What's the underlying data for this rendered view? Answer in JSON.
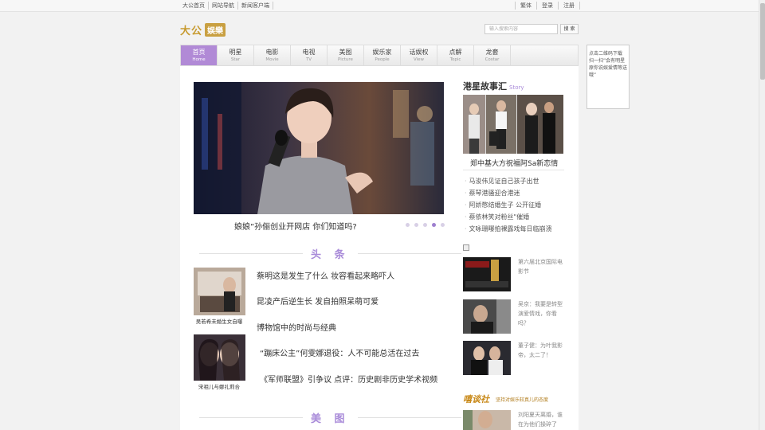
{
  "topbar": {
    "left_links": [
      "大公首页",
      "网站导航",
      "新闻客户端"
    ],
    "right_links": [
      "繁体",
      "登录",
      "注册"
    ]
  },
  "logo": {
    "brand": "大公",
    "section": "娱樂"
  },
  "search": {
    "placeholder": "输入搜索内容",
    "button": "搜 索"
  },
  "nav": [
    {
      "cn": "首页",
      "en": "Home",
      "active": true
    },
    {
      "cn": "明星",
      "en": "Star"
    },
    {
      "cn": "电影",
      "en": "Movie"
    },
    {
      "cn": "电视",
      "en": "TV"
    },
    {
      "cn": "美图",
      "en": "Picture"
    },
    {
      "cn": "娱乐家",
      "en": "People"
    },
    {
      "cn": "话娱权",
      "en": "View"
    },
    {
      "cn": "点解",
      "en": "Topic"
    },
    {
      "cn": "龙套",
      "en": "Costar"
    }
  ],
  "hero": {
    "caption": "娘娘”孙俪创业开网店 你们知道吗?",
    "slides": 5,
    "active_slide": 4
  },
  "sections": {
    "headline": "头 条",
    "pictures": "美 图"
  },
  "headline_thumbs": [
    {
      "caption": "吴若希未婚生女自曝"
    },
    {
      "caption": "宋祖儿与娜扎莉合"
    }
  ],
  "headline_links": [
    "蔡明这是发生了什么 妆容看起来略吓人",
    "昆凌产后逆生长 发自拍照呆萌可爱",
    "博物馆中的时尚与经典",
    "“蹦床公主”何雯娜退役：人不可能总活在过去",
    "《军师联盟》引争议 点评：历史剧非历史学术视频"
  ],
  "story": {
    "title": "港星故事汇",
    "title_en": "Story",
    "feature": "郑中基大方祝福阿Sa新恋情",
    "list": [
      "马浚伟见证自己孩子出世",
      "蔡琴港骚迎合港迷",
      "阿娇憋结婚生子 公开征婚",
      "蔡依林笑对粉丝\"催婚",
      "文咏珊曝拍裸露戏每日临崩溃"
    ]
  },
  "side_items": [
    {
      "text": "第六届北京国际电影节"
    },
    {
      "text": "吴京：我要是转型演爱情戏，你看吗？"
    },
    {
      "text": "董子健：为叶我影帝，太二了！"
    },
    {
      "text": "刘阳夏天离婚，谁在为他们操碎了"
    }
  ],
  "gossip": {
    "logo": "嘻谈社",
    "tagline": "坚持对娱乐较真儿的态度"
  },
  "ad": {
    "text": "点击二维码下载 扫一扫”会有明星 原你说娱爱情等送 哦”"
  },
  "colors": {
    "accent": "#a98bd9",
    "nav_active": "#b18ad6",
    "gold": "#c9a042"
  }
}
